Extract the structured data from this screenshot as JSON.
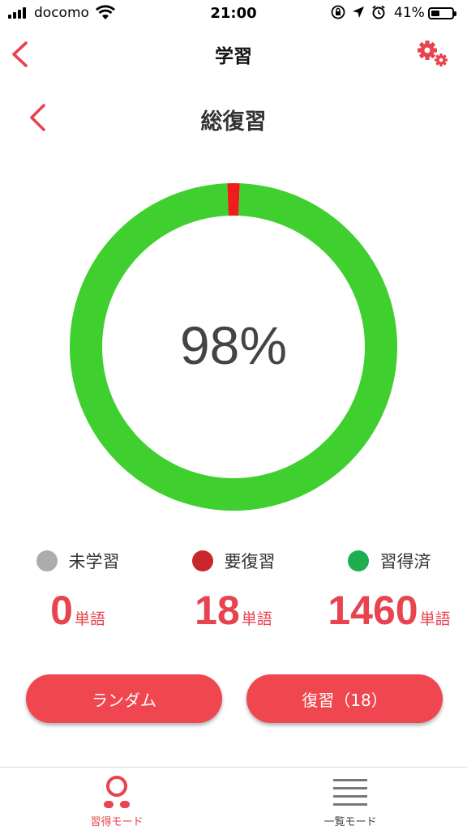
{
  "status_bar": {
    "carrier": "docomo",
    "time": "21:00",
    "battery": "41%",
    "battery_level": 0.41,
    "icons": [
      "orientation-lock-icon",
      "location-arrow-icon",
      "alarm-icon"
    ]
  },
  "nav": {
    "title": "学習",
    "back_icon": "chevron-left-icon",
    "settings_icon": "gear-icon"
  },
  "section": {
    "title": "総復習"
  },
  "progress": {
    "percent_text": "98%",
    "segments": [
      {
        "key": "unlearned",
        "value": 0,
        "color": "#b5b5b5"
      },
      {
        "key": "review",
        "value": 18,
        "color": "#ee1c1c"
      },
      {
        "key": "learned",
        "value": 1460,
        "color": "#3fcf2f"
      }
    ]
  },
  "legend": {
    "unlearned": {
      "label": "未学習",
      "count": "0",
      "unit": "単語",
      "color": "#acacac"
    },
    "review": {
      "label": "要復習",
      "count": "18",
      "unit": "単語",
      "color": "#c8262b"
    },
    "learned": {
      "label": "習得済",
      "count": "1460",
      "unit": "単語",
      "color": "#1fae4f"
    }
  },
  "buttons": {
    "random": "ランダム",
    "review": "復習（18）"
  },
  "tab_bar": {
    "learn_mode": "習得モード",
    "list_mode": "一覧モード",
    "active_color": "#e8434e",
    "inactive_color": "#444444"
  }
}
